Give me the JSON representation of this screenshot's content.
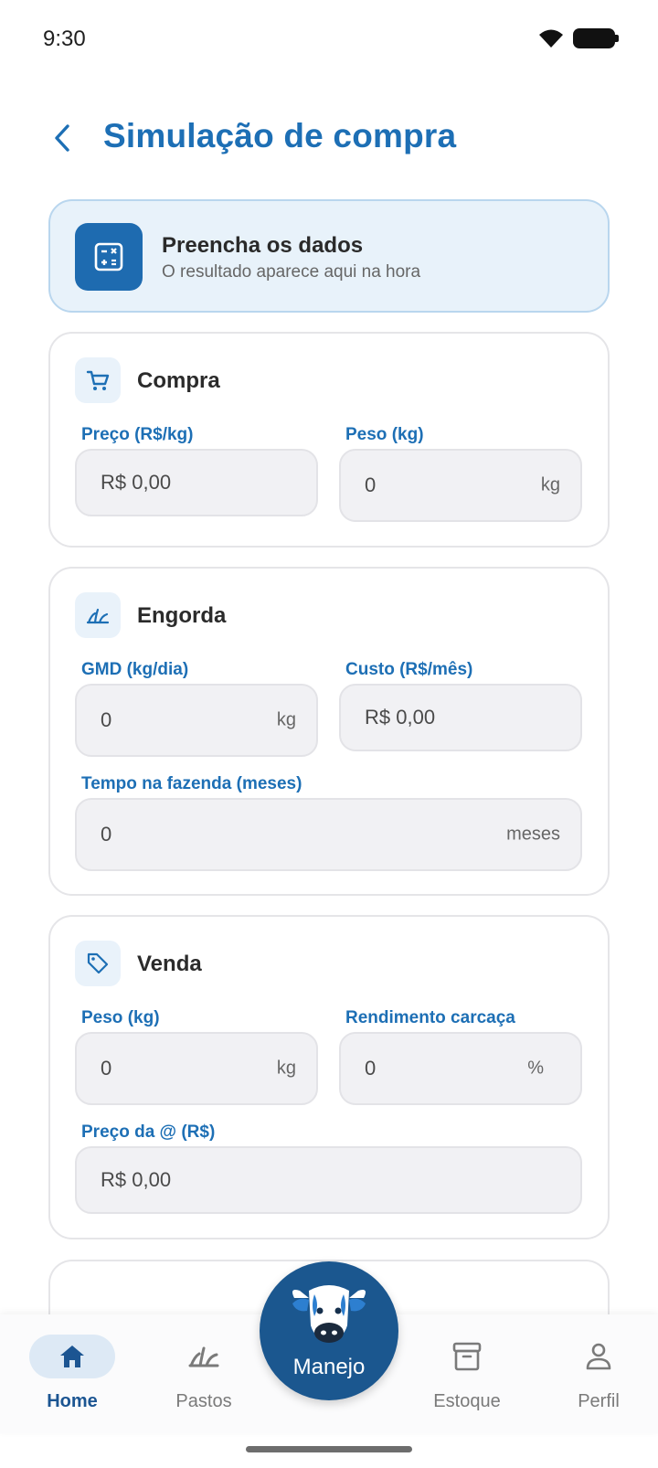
{
  "status_bar": {
    "time": "9:30"
  },
  "header": {
    "title": "Simulação de compra"
  },
  "banner": {
    "title": "Preencha os dados",
    "subtitle": "O resultado aparece aqui na hora"
  },
  "compra": {
    "title": "Compra",
    "preco_label": "Preço (R$/kg)",
    "preco_value": "R$ 0,00",
    "peso_label": "Peso (kg)",
    "peso_value": "0",
    "peso_suffix": "kg"
  },
  "engorda": {
    "title": "Engorda",
    "gmd_label": "GMD (kg/dia)",
    "gmd_value": "0",
    "gmd_suffix": "kg",
    "custo_label": "Custo (R$/mês)",
    "custo_value": "R$ 0,00",
    "tempo_label": "Tempo na fazenda (meses)",
    "tempo_value": "0",
    "tempo_suffix": "meses"
  },
  "venda": {
    "title": "Venda",
    "peso_label": "Peso (kg)",
    "peso_value": "0",
    "peso_suffix": "kg",
    "rendimento_label": "Rendimento carcaça",
    "rendimento_value": "0",
    "rendimento_suffix": "%",
    "preco_label": "Preço da @ (R$)",
    "preco_value": "R$ 0,00"
  },
  "bottom_nav": {
    "items": [
      {
        "label": "Home",
        "icon": "home-icon",
        "active": true
      },
      {
        "label": "Pastos",
        "icon": "grass-icon"
      },
      {
        "label": "Estoque",
        "icon": "archive-icon"
      },
      {
        "label": "Perfil",
        "icon": "person-icon"
      }
    ],
    "fab_label": "Manejo"
  },
  "colors": {
    "primary": "#1d6fb5",
    "fab": "#1b578f",
    "banner_bg": "#e8f2fa",
    "field_bg": "#f1f1f4"
  }
}
